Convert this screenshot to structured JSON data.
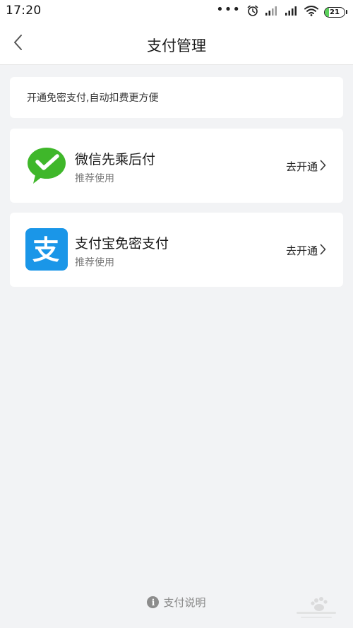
{
  "status_bar": {
    "time": "17:20",
    "dots": "•••",
    "battery_level": "21",
    "battery_fraction": 0.21,
    "icons": [
      "more-dots-icon",
      "alarm-clock-icon",
      "signal-icon",
      "signal-icon",
      "wifi-icon",
      "battery-icon"
    ]
  },
  "nav": {
    "title": "支付管理",
    "back_icon": "chevron-left-icon"
  },
  "notice": {
    "text": "开通免密支付,自动扣费更方便"
  },
  "payments": [
    {
      "title": "微信先乘后付",
      "subtitle": "推荐使用",
      "action": "去开通",
      "icon": "wechat-pay-icon"
    },
    {
      "title": "支付宝免密支付",
      "subtitle": "推荐使用",
      "action": "去开通",
      "icon": "alipay-icon",
      "logo_char": "支"
    }
  ],
  "footer": {
    "info_glyph": "i",
    "label": "支付说明"
  },
  "colors": {
    "background": "#f2f3f5",
    "card": "#ffffff",
    "wechat_green": "#3fb72a",
    "alipay_blue": "#1a96e8",
    "battery_green": "#5ad05a"
  }
}
